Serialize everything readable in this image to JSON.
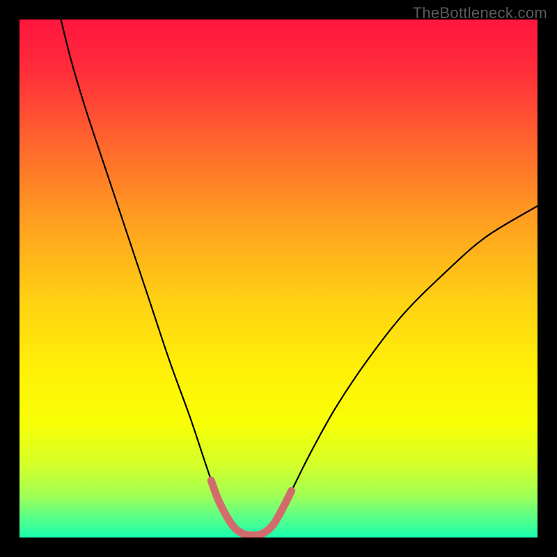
{
  "watermark": "TheBottleneck.com",
  "chart_data": {
    "type": "line",
    "title": "",
    "xlabel": "",
    "ylabel": "",
    "xlim": [
      0,
      100
    ],
    "ylim": [
      0,
      100
    ],
    "gradient_stops": [
      {
        "offset": 0.0,
        "color": "#ff163f"
      },
      {
        "offset": 0.1,
        "color": "#ff2d3a"
      },
      {
        "offset": 0.25,
        "color": "#ff6a2c"
      },
      {
        "offset": 0.4,
        "color": "#ffa31f"
      },
      {
        "offset": 0.55,
        "color": "#ffd313"
      },
      {
        "offset": 0.68,
        "color": "#fff107"
      },
      {
        "offset": 0.78,
        "color": "#f8ff06"
      },
      {
        "offset": 0.86,
        "color": "#d4ff29"
      },
      {
        "offset": 0.92,
        "color": "#9fff56"
      },
      {
        "offset": 0.96,
        "color": "#5bff88"
      },
      {
        "offset": 1.0,
        "color": "#18ffad"
      }
    ],
    "series": [
      {
        "name": "bottleneck-curve",
        "stroke": "#000000",
        "points": [
          {
            "x": 8.0,
            "y": 100.0
          },
          {
            "x": 10.0,
            "y": 92.0
          },
          {
            "x": 13.0,
            "y": 82.0
          },
          {
            "x": 17.0,
            "y": 70.0
          },
          {
            "x": 21.0,
            "y": 58.0
          },
          {
            "x": 25.0,
            "y": 46.0
          },
          {
            "x": 29.0,
            "y": 34.0
          },
          {
            "x": 33.0,
            "y": 23.0
          },
          {
            "x": 36.0,
            "y": 14.0
          },
          {
            "x": 38.5,
            "y": 7.0
          },
          {
            "x": 41.0,
            "y": 2.5
          },
          {
            "x": 43.0,
            "y": 0.8
          },
          {
            "x": 45.0,
            "y": 0.4
          },
          {
            "x": 47.0,
            "y": 0.8
          },
          {
            "x": 49.0,
            "y": 2.5
          },
          {
            "x": 52.0,
            "y": 8.0
          },
          {
            "x": 56.0,
            "y": 16.0
          },
          {
            "x": 61.0,
            "y": 25.0
          },
          {
            "x": 67.0,
            "y": 34.0
          },
          {
            "x": 74.0,
            "y": 43.0
          },
          {
            "x": 82.0,
            "y": 51.0
          },
          {
            "x": 90.0,
            "y": 58.0
          },
          {
            "x": 100.0,
            "y": 64.0
          }
        ]
      },
      {
        "name": "highlight-segment",
        "stroke": "#d26b6b",
        "points": [
          {
            "x": 37.0,
            "y": 11.0
          },
          {
            "x": 38.5,
            "y": 7.0
          },
          {
            "x": 41.0,
            "y": 2.5
          },
          {
            "x": 43.0,
            "y": 0.8
          },
          {
            "x": 45.0,
            "y": 0.4
          },
          {
            "x": 47.0,
            "y": 0.8
          },
          {
            "x": 49.0,
            "y": 2.5
          },
          {
            "x": 51.0,
            "y": 6.0
          },
          {
            "x": 52.5,
            "y": 9.0
          }
        ]
      }
    ]
  }
}
